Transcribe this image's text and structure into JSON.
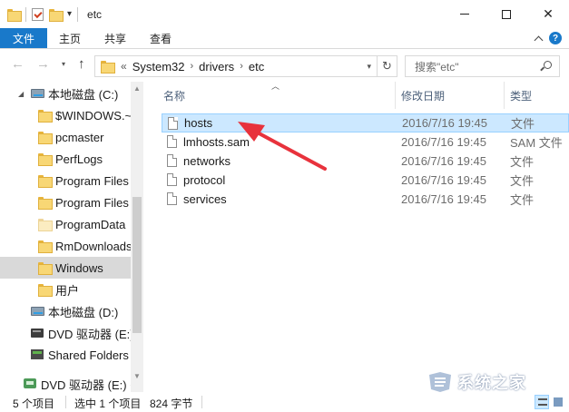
{
  "window": {
    "title": "etc",
    "minimize_glyph": "",
    "maximize_glyph": "",
    "close_glyph": "✕"
  },
  "ribbon": {
    "tabs": [
      "文件",
      "主页",
      "共享",
      "查看"
    ],
    "help_glyph": "?"
  },
  "address": {
    "back_glyph": "←",
    "forward_glyph": "→",
    "up_glyph": "↑",
    "overflow_glyph": "«",
    "crumbs": [
      "System32",
      "drivers",
      "etc"
    ],
    "crumb_sep": "›",
    "search_placeholder": "搜索\"etc\"",
    "refresh_glyph": "↻"
  },
  "nav": {
    "items": [
      {
        "label": "本地磁盘 (C:)",
        "icon": "drive-icon"
      },
      {
        "label": "$WINDOWS.~",
        "icon": "folder-icon"
      },
      {
        "label": "pcmaster",
        "icon": "folder-icon"
      },
      {
        "label": "PerfLogs",
        "icon": "folder-icon"
      },
      {
        "label": "Program Files",
        "icon": "folder-icon"
      },
      {
        "label": "Program Files",
        "icon": "folder-icon"
      },
      {
        "label": "ProgramData",
        "icon": "folder-icon"
      },
      {
        "label": "RmDownloads",
        "icon": "folder-icon"
      },
      {
        "label": "Windows",
        "icon": "folder-icon",
        "selected": true
      },
      {
        "label": "用户",
        "icon": "folder-icon"
      },
      {
        "label": "本地磁盘 (D:)",
        "icon": "drive-icon"
      },
      {
        "label": "DVD 驱动器 (E:)",
        "icon": "dvd-drive-icon"
      },
      {
        "label": "Shared Folders",
        "icon": "network-share-icon"
      },
      {
        "label": "DVD 驱动器 (E:) C",
        "icon": "dvd-drive-icon"
      }
    ]
  },
  "files": {
    "columns": {
      "name": "名称",
      "date": "修改日期",
      "type": "类型"
    },
    "rows": [
      {
        "name": "hosts",
        "date": "2016/7/16 19:45",
        "type": "文件",
        "selected": true
      },
      {
        "name": "lmhosts.sam",
        "date": "2016/7/16 19:45",
        "type": "SAM 文件"
      },
      {
        "name": "networks",
        "date": "2016/7/16 19:45",
        "type": "文件"
      },
      {
        "name": "protocol",
        "date": "2016/7/16 19:45",
        "type": "文件"
      },
      {
        "name": "services",
        "date": "2016/7/16 19:45",
        "type": "文件"
      }
    ]
  },
  "status": {
    "count": "5 个项目",
    "selection": "选中 1 个项目",
    "size": "824 字节"
  },
  "watermark": {
    "text": "系统之家"
  },
  "colors": {
    "file_tab": "#1979ca",
    "selection_bg": "#cce8ff",
    "selection_border": "#99d1ff",
    "arrow_red": "#e8323c",
    "header_text": "#4c607a"
  }
}
